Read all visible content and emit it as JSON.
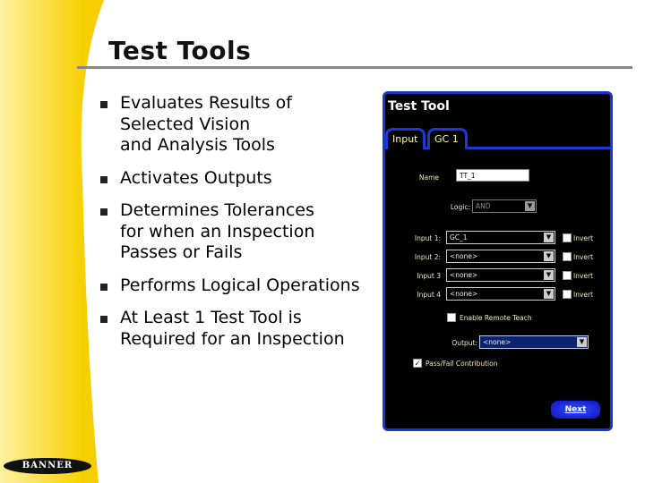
{
  "slide": {
    "title": "Test Tools",
    "logo": "BANNER",
    "bullets": [
      "Evaluates Results of\nSelected Vision\nand Analysis Tools",
      "Activates Outputs",
      "Determines Tolerances\nfor when an Inspection\nPasses or Fails",
      "Performs Logical Operations",
      "At Least 1 Test Tool is\nRequired for an Inspection"
    ]
  },
  "window": {
    "title": "Test Tool",
    "tabs": [
      "Input",
      "GC  1"
    ],
    "name_label": "Name",
    "name_value": "TT_1",
    "logic_label": "Logic:",
    "logic_value": "AND",
    "inputs": [
      {
        "label": "Input 1:",
        "value": "GC_1",
        "invert": "Invert"
      },
      {
        "label": "Input 2:",
        "value": "<none>",
        "invert": "Invert"
      },
      {
        "label": "Input 3",
        "value": "<none>",
        "invert": "Invert"
      },
      {
        "label": "Input 4",
        "value": "<none>",
        "invert": "Invert"
      }
    ],
    "remote_teach": "Enable Remote Teach",
    "output_label": "Output:",
    "output_value": "<none>",
    "passfail": "Pass/Fail Contribution",
    "passfail_checked": true,
    "next": "Next"
  }
}
